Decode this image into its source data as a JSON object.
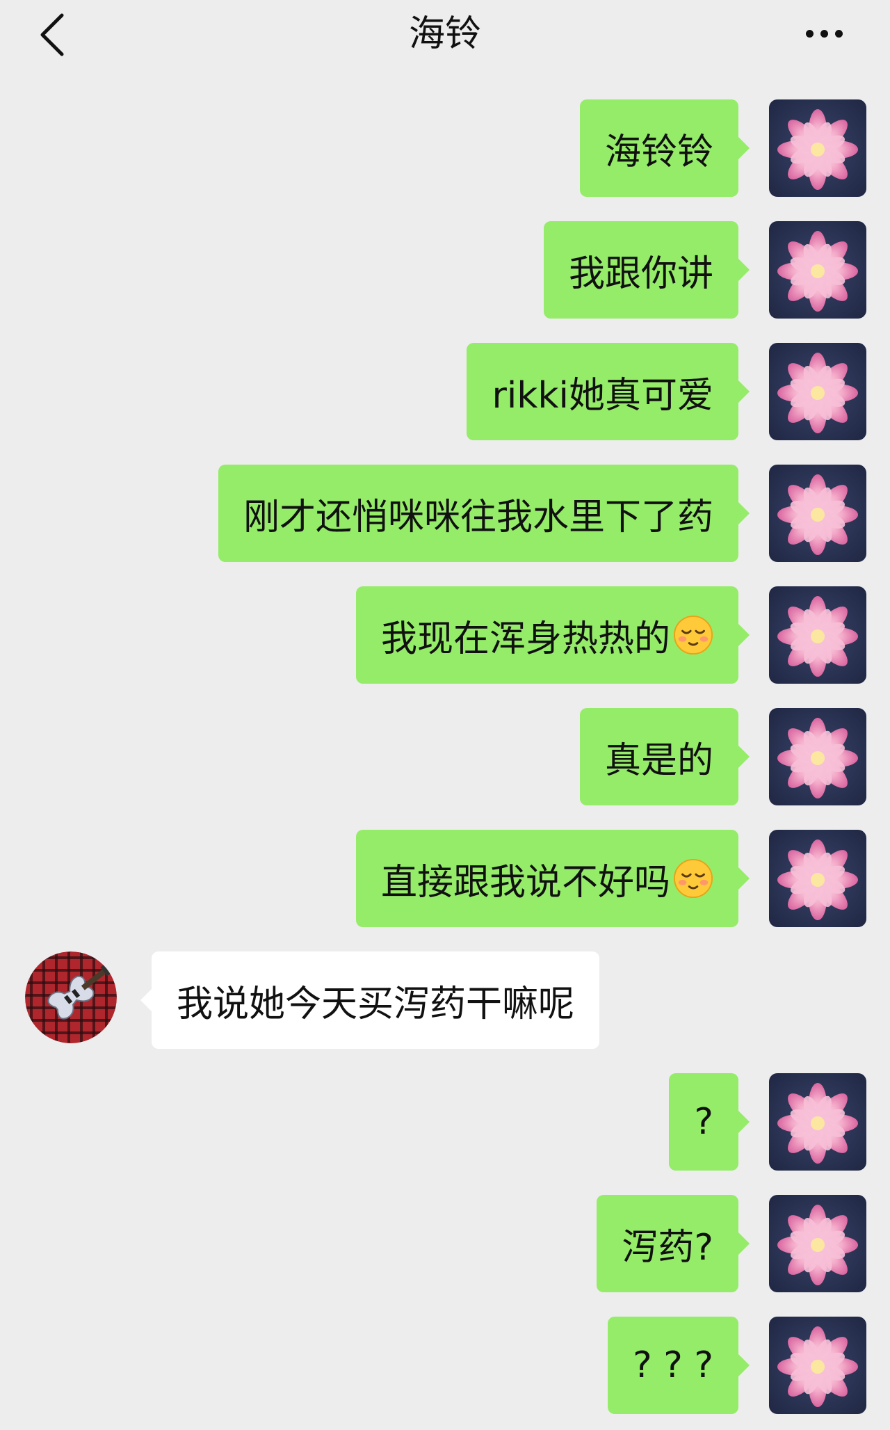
{
  "header": {
    "title": "海铃",
    "back_icon": "chevron-left-icon",
    "more_icon": "more-dots-icon"
  },
  "avatars": {
    "self_icon": "lotus-flower-avatar",
    "other_icon": "bass-guitar-plaid-avatar"
  },
  "colors": {
    "background": "#ededed",
    "outgoing_bubble": "#95ec69",
    "incoming_bubble": "#ffffff"
  },
  "messages": [
    {
      "side": "out",
      "text": "海铃铃"
    },
    {
      "side": "out",
      "text": "我跟你讲"
    },
    {
      "side": "out",
      "text": "rikki她真可爱"
    },
    {
      "side": "out",
      "text": "刚才还悄咪咪往我水里下了药"
    },
    {
      "side": "out",
      "text": "我现在浑身热热的",
      "emoji": "blushing-face-icon"
    },
    {
      "side": "out",
      "text": "真是的"
    },
    {
      "side": "out",
      "text": "直接跟我说不好吗",
      "emoji": "blushing-face-icon"
    },
    {
      "side": "in",
      "text": "我说她今天买泻药干嘛呢"
    },
    {
      "side": "out",
      "text": "?"
    },
    {
      "side": "out",
      "text": "泻药?"
    },
    {
      "side": "out",
      "text": "? ? ?"
    }
  ]
}
